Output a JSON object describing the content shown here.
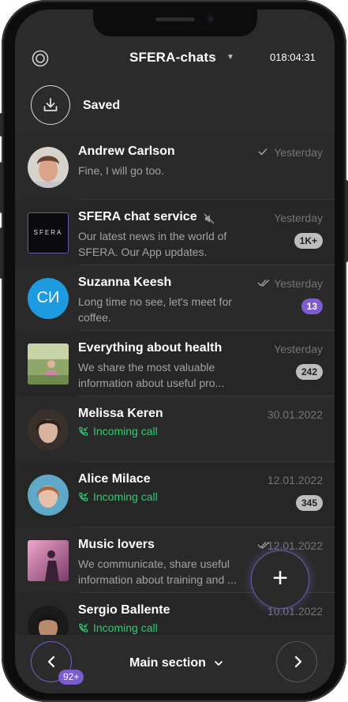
{
  "header": {
    "title": "SFERA-chats",
    "clock": "018:04:31",
    "saved_label": "Saved"
  },
  "chats": [
    {
      "name": "Andrew Carlson",
      "message": "Fine, I will go too.",
      "time": "Yesterday",
      "status": "read-single",
      "avatar_initials": ""
    },
    {
      "name": "SFERA chat service",
      "message": "Our latest news in the world of SFERA. Our App updates.",
      "time": "Yesterday",
      "muted": true,
      "badge": "1K+",
      "avatar_text": "SFERA"
    },
    {
      "name": "Suzanna Keesh",
      "message": "Long time no see, let's meet for coffee.",
      "time": "Yesterday",
      "status": "read-double",
      "badge": "13",
      "avatar_initials": "СИ"
    },
    {
      "name": "Everything about health",
      "message": "We share the most valuable information about useful pro...",
      "time": "Yesterday",
      "badge": "242"
    },
    {
      "name": "Melissa Keren",
      "message": "Incoming call",
      "time": "30.01.2022"
    },
    {
      "name": "Alice Milace",
      "message": "Incoming call",
      "time": "12.01.2022",
      "badge": "345"
    },
    {
      "name": "Music lovers",
      "message": "We communicate, share useful information about training and ...",
      "time": "12.01.2022",
      "status": "read-double"
    },
    {
      "name": "Sergio Ballente",
      "message": "Incoming call",
      "time": "10.01.2022"
    }
  ],
  "fab": {
    "label": "+"
  },
  "footer": {
    "section_label": "Main section",
    "prev_badge": "92+"
  },
  "colors": {
    "accent": "#7c5ccf",
    "call_green": "#2ecc71",
    "background": "#262626"
  },
  "icons": [
    "settings-icon",
    "download-icon",
    "mute-icon",
    "check-icon",
    "double-check-icon",
    "incoming-call-icon",
    "plus-icon",
    "chevron-left-icon",
    "chevron-right-icon",
    "chevron-down-icon"
  ]
}
